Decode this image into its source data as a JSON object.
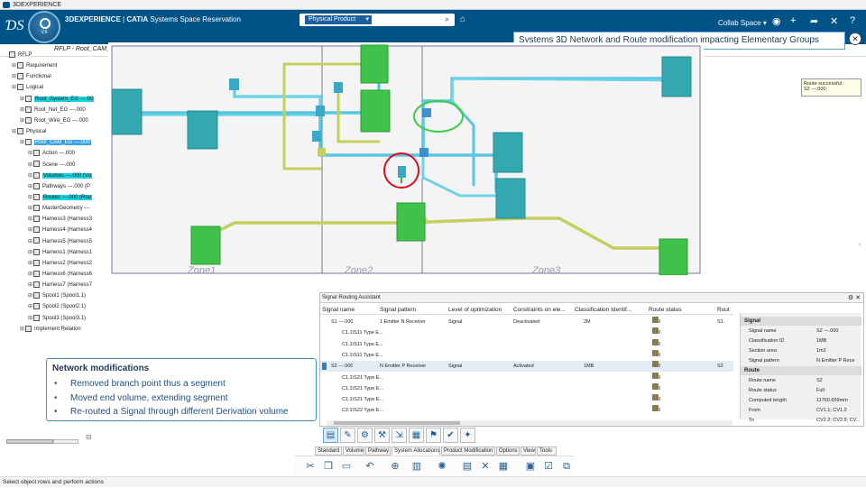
{
  "app": {
    "window_title": "3DEXPERIENCE",
    "compass_version": "V.6",
    "brand": "3DEXPERIENCE",
    "product": "CATIA",
    "app_name": "Systems Space Reservation",
    "search_chip": "Physical Product",
    "collab_space": "Collab Space",
    "accent": "#005386"
  },
  "doc_tab": {
    "label": "RFLP - Root_CAM_EG ---.0",
    "plus": "+"
  },
  "banner": {
    "text": "Systems 3D Network and Route modification impacting Elementary Groups"
  },
  "route_message": {
    "line1": "Route successful :",
    "line2": "S2 ---.000;"
  },
  "tree": [
    {
      "label": "RFLP",
      "depth": 0,
      "hl": ""
    },
    {
      "label": "Requirement",
      "depth": 1,
      "hl": ""
    },
    {
      "label": "Functional",
      "depth": 1,
      "hl": ""
    },
    {
      "label": "Logical",
      "depth": 1,
      "hl": ""
    },
    {
      "label": "Root_System_EG ---.00",
      "depth": 2,
      "hl": "cyan"
    },
    {
      "label": "Root_Net_EG ---.000",
      "depth": 2,
      "hl": ""
    },
    {
      "label": "Root_Wire_EG ---.000",
      "depth": 2,
      "hl": ""
    },
    {
      "label": "Physical",
      "depth": 1,
      "hl": ""
    },
    {
      "label": "Root_CAM_EG ---.000",
      "depth": 2,
      "hl": "blue"
    },
    {
      "label": "Action ---.000",
      "depth": 3,
      "hl": ""
    },
    {
      "label": "Scene ---.000",
      "depth": 3,
      "hl": ""
    },
    {
      "label": "Volumes ---.000 (Vo",
      "depth": 3,
      "hl": "cyan"
    },
    {
      "label": "Pathways ---.000 (P",
      "depth": 3,
      "hl": ""
    },
    {
      "label": "Routes ---.000 (Rou",
      "depth": 3,
      "hl": "cyan"
    },
    {
      "label": "MasterGeometry ---",
      "depth": 3,
      "hl": ""
    },
    {
      "label": "Harness3 (Harness3",
      "depth": 3,
      "hl": ""
    },
    {
      "label": "Harness4 (Harness4",
      "depth": 3,
      "hl": ""
    },
    {
      "label": "Harness5 (Harness5",
      "depth": 3,
      "hl": ""
    },
    {
      "label": "Harness1 (Harness1",
      "depth": 3,
      "hl": ""
    },
    {
      "label": "Harness2 (Harness2",
      "depth": 3,
      "hl": ""
    },
    {
      "label": "Harness6 (Harness6",
      "depth": 3,
      "hl": ""
    },
    {
      "label": "Harness7 (Harness7",
      "depth": 3,
      "hl": ""
    },
    {
      "label": "Spool1 (Spool1.1)",
      "depth": 3,
      "hl": ""
    },
    {
      "label": "Spool2 (Spool2.1)",
      "depth": 3,
      "hl": ""
    },
    {
      "label": "Spool3 (Spool3.1)",
      "depth": 3,
      "hl": ""
    },
    {
      "label": "Implement Relation",
      "depth": 2,
      "hl": ""
    }
  ],
  "zones": [
    "Zone1",
    "Zone2",
    "Zone3"
  ],
  "panel": {
    "title": "Signal Routing Assistant",
    "columns": [
      "Signal name",
      "Signal pattern",
      "Level of optimization",
      "Constraints on ele...",
      "Classification Identif...",
      "Route status",
      "Rout"
    ],
    "rows": [
      {
        "name": "S1 ---.000",
        "pattern": "1 Emitter N Receiver",
        "level": "Signal",
        "constraint": "Deactivated",
        "class": "2M",
        "status": "Full",
        "route": "S1",
        "indent": 0,
        "sel": false
      },
      {
        "name": "C1.1\\S11 Type E...",
        "pattern": "",
        "level": "",
        "constraint": "",
        "class": "",
        "status": "Full",
        "route": "",
        "indent": 1,
        "sel": false
      },
      {
        "name": "C1.1\\S11 Type E...",
        "pattern": "",
        "level": "",
        "constraint": "",
        "class": "",
        "status": "Full",
        "route": "",
        "indent": 1,
        "sel": false
      },
      {
        "name": "C1.1\\S11 Type E...",
        "pattern": "",
        "level": "",
        "constraint": "",
        "class": "",
        "status": "Full",
        "route": "",
        "indent": 1,
        "sel": false
      },
      {
        "name": "S2 ---.000",
        "pattern": "N Emitter P Receiver",
        "level": "Signal",
        "constraint": "Activated",
        "class": "1MB",
        "status": "Full",
        "route": "S2",
        "indent": 0,
        "sel": true
      },
      {
        "name": "C1.1\\S21 Type E...",
        "pattern": "",
        "level": "",
        "constraint": "",
        "class": "",
        "status": "Full",
        "route": "",
        "indent": 1,
        "sel": false
      },
      {
        "name": "C1.1\\S21 Type E...",
        "pattern": "",
        "level": "",
        "constraint": "",
        "class": "",
        "status": "Full",
        "route": "",
        "indent": 1,
        "sel": false
      },
      {
        "name": "C1.1\\S21 Type E...",
        "pattern": "",
        "level": "",
        "constraint": "",
        "class": "",
        "status": "Full",
        "route": "",
        "indent": 1,
        "sel": false
      },
      {
        "name": "C2.1\\S22 Type E...",
        "pattern": "",
        "level": "",
        "constraint": "",
        "class": "",
        "status": "Full",
        "route": "",
        "indent": 1,
        "sel": false
      }
    ],
    "props_signal_header": "Signal",
    "props_signal": [
      {
        "k": "Signal name",
        "v": "S2 ---.000"
      },
      {
        "k": "Classification ID",
        "v": "1MB"
      },
      {
        "k": "Section area",
        "v": "1m2"
      },
      {
        "k": "Signal pattern",
        "v": "N Emitter P Rece"
      }
    ],
    "props_route_header": "Route",
    "props_route": [
      {
        "k": "Route name",
        "v": "S2"
      },
      {
        "k": "Route status",
        "v": "Full"
      },
      {
        "k": "Computed length",
        "v": "11760.659mm"
      },
      {
        "k": "From",
        "v": "CV1.1; CV1.2"
      },
      {
        "k": "To",
        "v": "CV2.2; CV2.5; CV..."
      }
    ]
  },
  "tool_tabs": [
    "Standard",
    "Volume",
    "Pathway",
    "System Allocations",
    "Product Modification",
    "Options",
    "View",
    "Tools"
  ],
  "network_box": {
    "title": "Network modifications",
    "items": [
      "Removed branch point thus a segment",
      "Moved end volume, extending segment",
      "Re-routed a Signal through different Derivation volume"
    ]
  },
  "status_bar": "Select object rows and perform actions"
}
